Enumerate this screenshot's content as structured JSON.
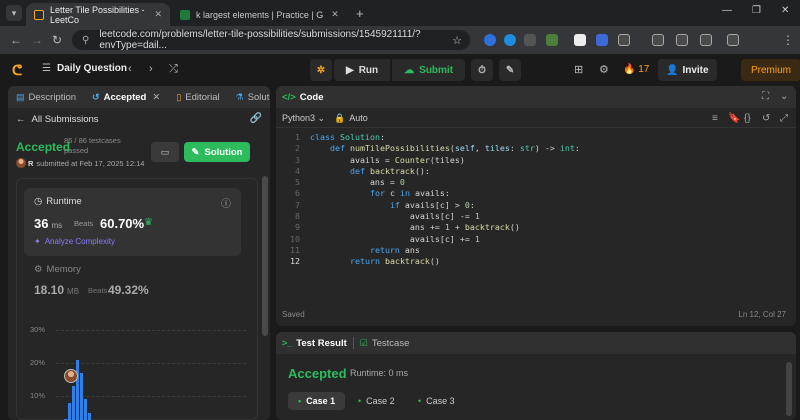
{
  "browser": {
    "tabs": [
      {
        "title": "Letter Tile Possibilities - LeetCo",
        "active": true
      },
      {
        "title": "k largest elements | Practice | G",
        "active": false
      }
    ],
    "url": "leetcode.com/problems/letter-tile-possibilities/submissions/1545921111/?envType=dail..."
  },
  "header": {
    "daily_question": "Daily Question",
    "run_label": "Run",
    "submit_label": "Submit",
    "streak": "17",
    "invite_label": "Invite",
    "premium_label": "Premium"
  },
  "left_panel": {
    "tabs": [
      "Description",
      "Accepted",
      "Editorial",
      "Solutions"
    ],
    "all_submissions": "All Submissions",
    "status": "Accepted",
    "testcases": "86 / 86 testcases passed",
    "submitter": "R",
    "submitted_text": "submitted at Feb 17, 2025 12:14",
    "solution_label": "Solution",
    "runtime": {
      "label": "Runtime",
      "value": "36",
      "unit": "ms",
      "beats_label": "Beats",
      "beats_pct": "60.70%",
      "analyze": "Analyze Complexity"
    },
    "memory": {
      "label": "Memory",
      "value": "18.10",
      "unit": "MB",
      "beats_label": "Beats",
      "beats_pct": "49.32%"
    },
    "chart_yticks": [
      "30%",
      "20%",
      "10%"
    ]
  },
  "code_panel": {
    "title": "Code",
    "language": "Python3",
    "mode": "Auto",
    "saved": "Saved",
    "cursor": "Ln 12, Col 27",
    "current_line": 12
  },
  "result_panel": {
    "tabs": [
      "Test Result",
      "Testcase"
    ],
    "status": "Accepted",
    "runtime": "Runtime: 0 ms",
    "cases": [
      "Case 1",
      "Case 2",
      "Case 3"
    ]
  },
  "colors": {
    "accent_green": "#2cbb5d",
    "accent_orange": "#ffa116",
    "chart_blue": "#2f7fe6"
  },
  "chart_data": {
    "type": "bar",
    "title": "",
    "ylabel": "",
    "ylim": [
      0,
      35
    ],
    "bins": [
      {
        "value": 3
      },
      {
        "value": 8
      },
      {
        "value": 13
      },
      {
        "value": 21
      },
      {
        "value": 17
      },
      {
        "value": 9
      },
      {
        "value": 5
      },
      {
        "value": 2
      }
    ]
  }
}
